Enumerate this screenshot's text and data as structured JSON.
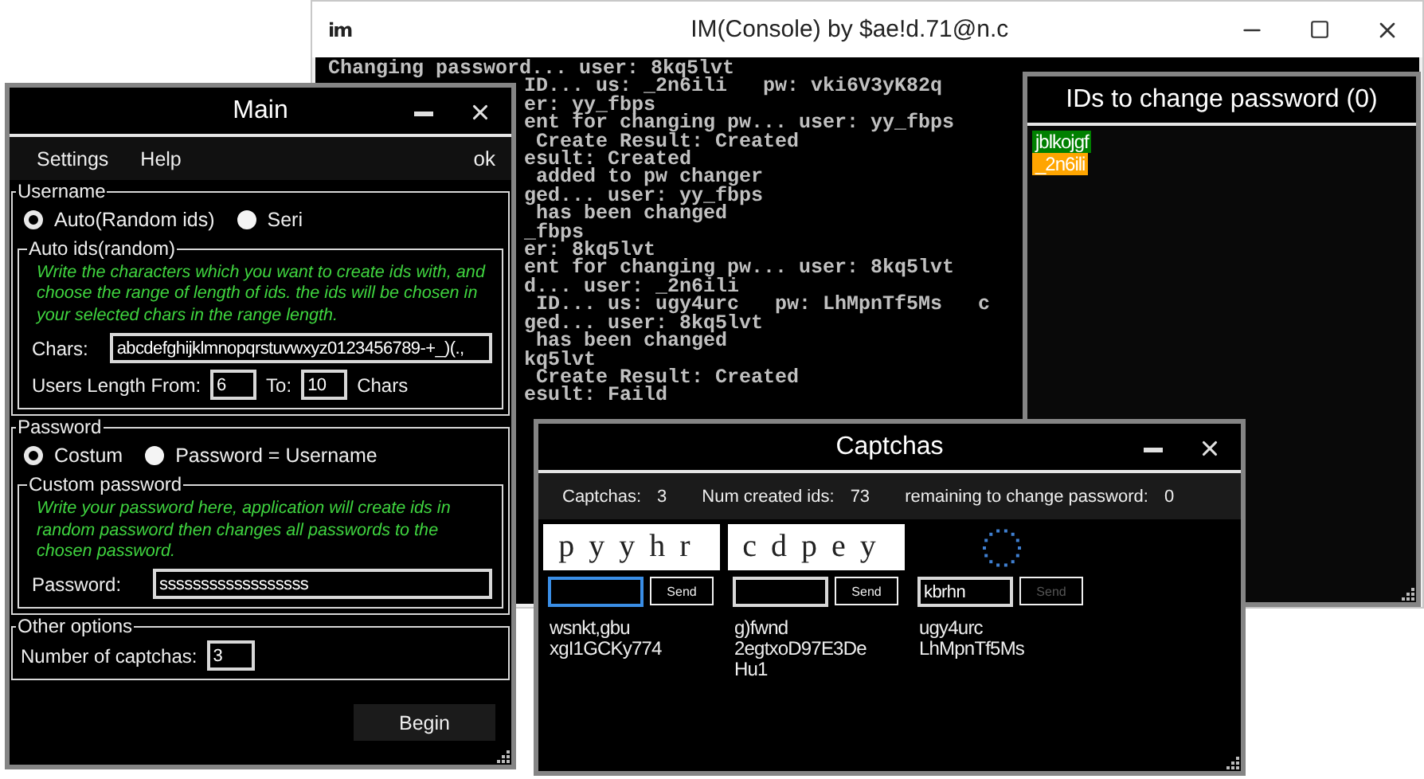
{
  "console": {
    "logo": "im",
    "title": "IM(Console) by $ae!d.71@n.c",
    "lines": [
      "Changing password... user: 8kq5lvt",
      "ID... us: _2n6ili   pw: vki6V3yK82q",
      "er: yy_fbps",
      "ent for changing pw... user: yy_fbps",
      " Create Result: Created",
      "esult: Created",
      " added to pw changer",
      "ged... user: yy_fbps",
      " has been changed",
      "_fbps",
      "er: 8kq5lvt",
      "ent for changing pw... user: 8kq5lvt",
      "d... user: _2n6ili",
      " ID... us: ugy4urc   pw: LhMpnTf5Ms   c",
      "ged... user: 8kq5lvt",
      " has been changed",
      "kq5lvt",
      " Create Result: Created",
      "esult: Faild"
    ]
  },
  "main": {
    "title": "Main",
    "menu": [
      {
        "label": "Settings"
      },
      {
        "label": "Help"
      }
    ],
    "menu_right": "ok",
    "username": {
      "legend": "Username",
      "options": [
        {
          "label": "Auto(Random ids)",
          "selected": true
        },
        {
          "label": "Seri",
          "selected": false
        }
      ],
      "auto": {
        "legend": "Auto ids(random)",
        "hint": "Write the characters which you want to create ids with, and choose the range of length of ids. the ids will be chosen in your selected chars in the range length.",
        "chars_label": "Chars:",
        "chars_value": "abcdefghijklmnopqrstuvwxyz0123456789-+_)(.,",
        "from_label": "Users Length From:",
        "from_value": "6",
        "to_label": "To:",
        "to_value": "10",
        "unit": "Chars"
      }
    },
    "password": {
      "legend": "Password",
      "options": [
        {
          "label": "Costum",
          "selected": true
        },
        {
          "label": "Password = Username",
          "selected": false
        }
      ],
      "custom": {
        "legend": "Custom password",
        "hint": "Write your password here, application will create ids in random password then changes all passwords to the chosen password.",
        "label": "Password:",
        "value": "ssssssssssssssssss"
      }
    },
    "other": {
      "legend": "Other options",
      "captchas_label": "Number of captchas:",
      "captchas_value": "3"
    },
    "begin": "Begin"
  },
  "ids": {
    "title": "IDs to change password (0)",
    "items": [
      {
        "label": "jblkojgf",
        "color": "#008000"
      },
      {
        "label": "_2n6ili",
        "color": "#ffa500"
      }
    ]
  },
  "captchas": {
    "title": "Captchas",
    "stats": [
      {
        "label": "Captchas:",
        "value": "3"
      },
      {
        "label": "Num created ids:",
        "value": "73"
      },
      {
        "label": "remaining to change password:",
        "value": "0"
      }
    ],
    "items": [
      {
        "kind": "image",
        "captcha_text": "pyyhr",
        "focused": true,
        "send": "Send",
        "send_disabled": false,
        "username": "wsnkt,gbu",
        "password": "xgI1GCKy774"
      },
      {
        "kind": "image",
        "captcha_text": "cdpey",
        "focused": false,
        "send": "Send",
        "send_disabled": false,
        "username": "g)fwnd",
        "password": "2egtxoD97E3DeHu1"
      },
      {
        "kind": "loading",
        "input": "kbrhn",
        "focused": false,
        "send": "Send",
        "send_disabled": true,
        "username": "ugy4urc",
        "password": "LhMpnTf5Ms"
      }
    ]
  }
}
